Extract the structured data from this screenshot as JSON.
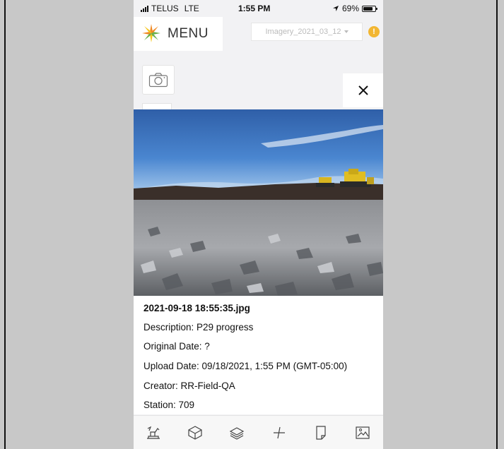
{
  "status_bar": {
    "carrier": "TELUS",
    "network": "LTE",
    "time": "1:55 PM",
    "battery": "69%"
  },
  "header": {
    "menu_label": "MENU",
    "imagery_selector": "Imagery_2021_03_12",
    "alert_symbol": "!"
  },
  "photo": {
    "filename": "2021-09-18 18:55:35.jpg",
    "description_label": "Description: P29 progress",
    "original_date_label": "Original Date: ?",
    "upload_date_label": "Upload Date: 09/18/2021, 1:55 PM (GMT-05:00)",
    "creator_label": "Creator: RR-Field-QA",
    "station_label": "Station: 709"
  },
  "toolbar": {
    "icons": [
      "excavator-icon",
      "cube-icon",
      "layers-icon",
      "measure-icon",
      "document-icon",
      "image-icon"
    ]
  },
  "colors": {
    "alert": "#f2b632",
    "logo_orange": "#f08a24",
    "logo_green": "#6ab04c",
    "logo_yellow": "#f5c518",
    "sky": "#3a73c2"
  }
}
